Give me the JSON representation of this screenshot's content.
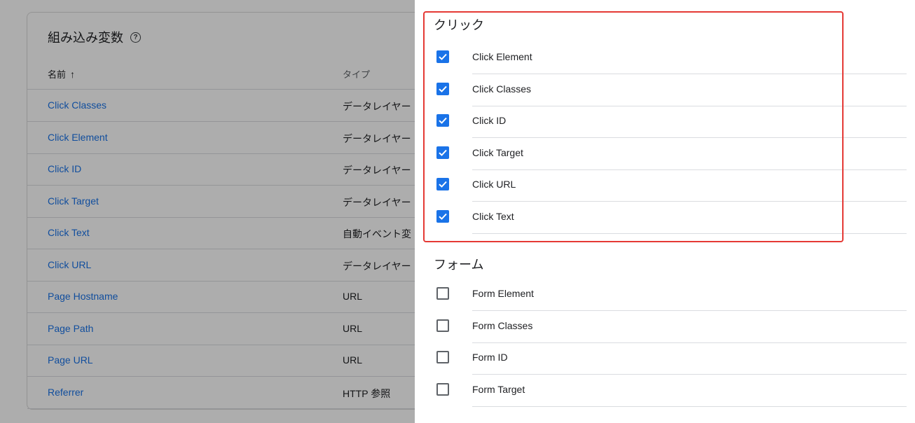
{
  "left": {
    "card_title": "組み込み変数",
    "help_icon": "help-circle-icon",
    "col_name": "名前",
    "sort_icon": "arrow-up-icon",
    "col_type": "タイプ",
    "rows": [
      {
        "name": "Click Classes",
        "type": "データレイヤー"
      },
      {
        "name": "Click Element",
        "type": "データレイヤー"
      },
      {
        "name": "Click ID",
        "type": "データレイヤー"
      },
      {
        "name": "Click Target",
        "type": "データレイヤー"
      },
      {
        "name": "Click Text",
        "type": "自動イベント変"
      },
      {
        "name": "Click URL",
        "type": "データレイヤー"
      },
      {
        "name": "Page Hostname",
        "type": "URL"
      },
      {
        "name": "Page Path",
        "type": "URL"
      },
      {
        "name": "Page URL",
        "type": "URL"
      },
      {
        "name": "Referrer",
        "type": "HTTP 参照"
      }
    ]
  },
  "panel": {
    "click_section": {
      "title": "クリック",
      "items": [
        {
          "label": "Click Element",
          "checked": true
        },
        {
          "label": "Click Classes",
          "checked": true
        },
        {
          "label": "Click ID",
          "checked": true
        },
        {
          "label": "Click Target",
          "checked": true
        },
        {
          "label": "Click URL",
          "checked": true
        },
        {
          "label": "Click Text",
          "checked": true
        }
      ]
    },
    "form_section": {
      "title": "フォーム",
      "items": [
        {
          "label": "Form Element",
          "checked": false
        },
        {
          "label": "Form Classes",
          "checked": false
        },
        {
          "label": "Form ID",
          "checked": false
        },
        {
          "label": "Form Target",
          "checked": false
        }
      ]
    }
  },
  "colors": {
    "accent": "#1a73e8",
    "highlight": "#e53935",
    "overlay": "rgba(0,0,0,0.32)"
  }
}
